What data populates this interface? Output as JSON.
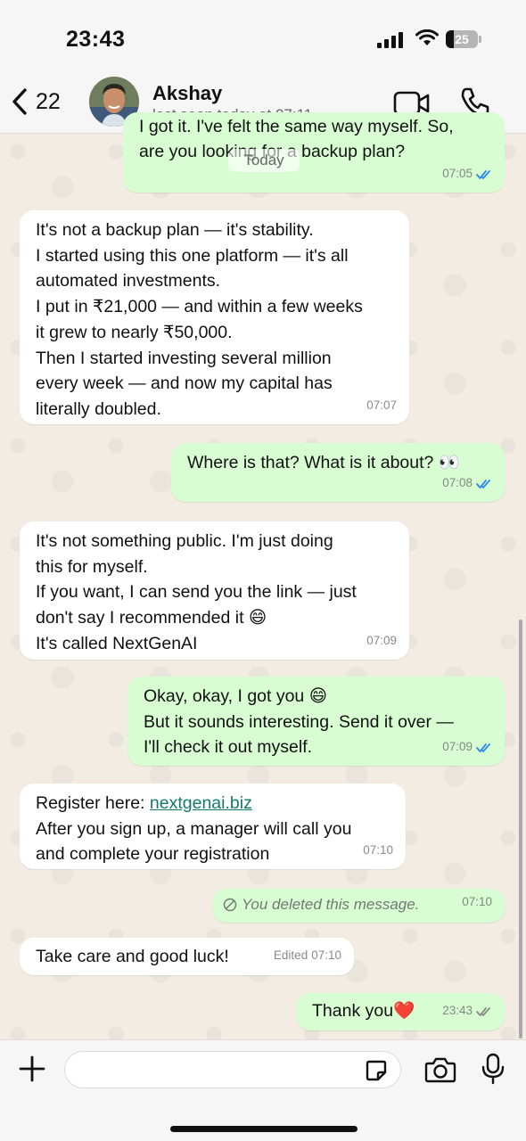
{
  "status_bar": {
    "time": "23:43",
    "battery_pct": "25",
    "battery_level": 0.25
  },
  "header": {
    "back_count": "22",
    "contact_name": "Akshay",
    "contact_status": "last seen today at 07:11"
  },
  "chat": {
    "date_chip": "Today",
    "partial_top_text": "I got it. I've felt the same way myself. So,",
    "messages": [
      {
        "dir": "out",
        "lines": [
          "are you looking for a backup plan?"
        ],
        "time": "07:05",
        "read": true
      },
      {
        "dir": "in",
        "lines": [
          "It's not a backup plan — it's stability.",
          "I started using this one platform — it's all",
          "automated investments.",
          "I put in ₹21,000 — and within a few weeks",
          "it grew to nearly ₹50,000.",
          "Then I started investing several million",
          "every week — and now my capital has",
          "literally doubled."
        ],
        "time": "07:07"
      },
      {
        "dir": "out",
        "lines": [
          "Where is that? What is it about? 👀"
        ],
        "time": "07:08",
        "read": true
      },
      {
        "dir": "in",
        "lines": [
          "It's not something public. I'm just doing",
          "this for myself.",
          "If you want, I can send you the link — just",
          "don't say I recommended it 😄",
          "It's called NextGenAI"
        ],
        "time": "07:09"
      },
      {
        "dir": "out",
        "lines": [
          "Okay, okay, I got you 😄",
          "But it sounds interesting. Send it over —",
          "I'll check it out myself."
        ],
        "time": "07:09",
        "read": true
      },
      {
        "dir": "in",
        "prefix": "Register here: ",
        "link": "nextgenai.biz",
        "lines": [
          "After you sign up, a manager will call you",
          "and complete your registration"
        ],
        "time": "07:10"
      },
      {
        "dir": "out",
        "deleted": "You deleted this message.",
        "time": "07:10"
      },
      {
        "dir": "in",
        "lines": [
          "Take care and good luck!"
        ],
        "time": "07:10",
        "edited_label": "Edited"
      },
      {
        "dir": "out",
        "lines": [
          "Thank you❤️"
        ],
        "time": "23:43",
        "read": false
      }
    ]
  },
  "composer": {
    "placeholder": ""
  },
  "colors": {
    "outgoing_bubble": "#d9fdd3",
    "incoming_bubble": "#ffffff",
    "read_tick": "#2c8be8",
    "link": "#157a6e"
  }
}
